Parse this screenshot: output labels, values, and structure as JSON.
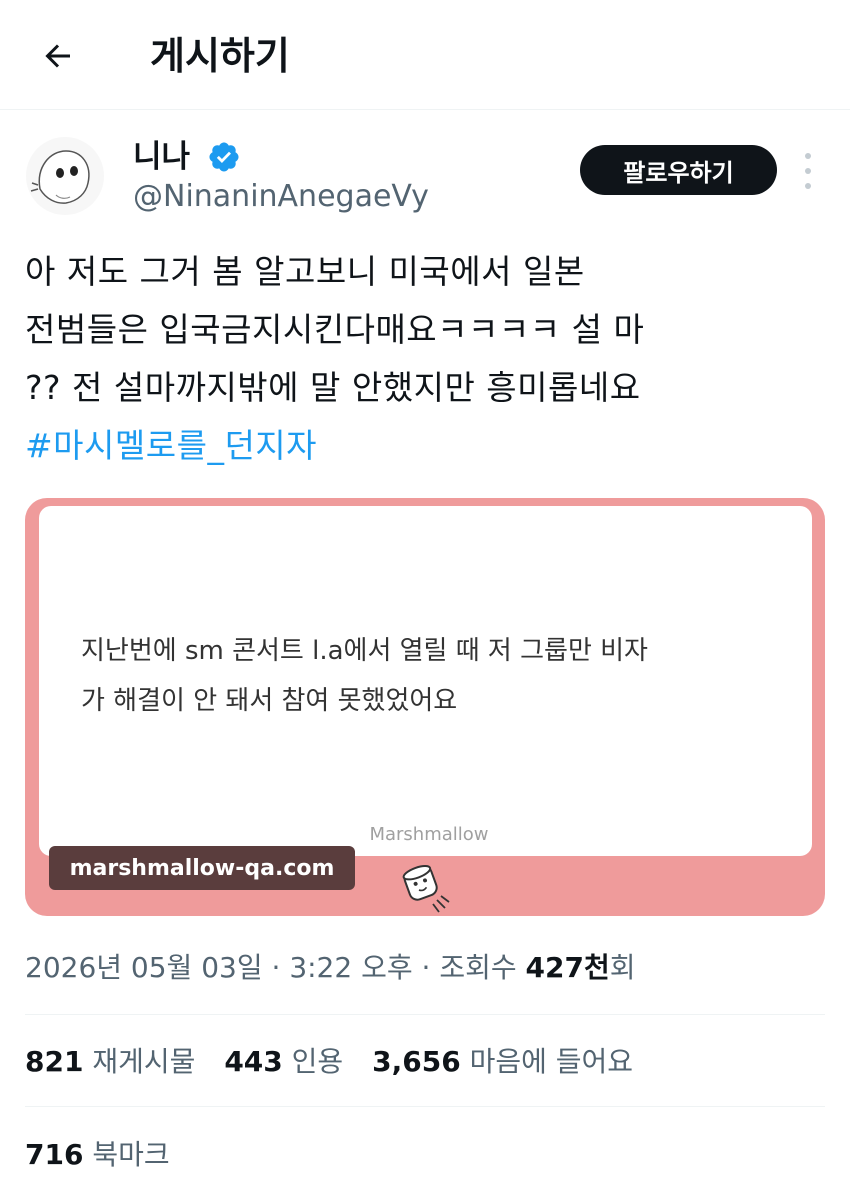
{
  "header": {
    "title": "게시하기",
    "back_icon": "arrow-left-icon"
  },
  "author": {
    "name": "니나",
    "handle": "@NinaninAnegaeVy",
    "verified_icon": "verified-badge-icon",
    "follow_label": "팔로우하기",
    "more_icon": "more-vertical-icon"
  },
  "tweet": {
    "lines": [
      "아 저도 그거 봄 알고보니 미국에서 일본",
      "전범들은 입국금지시킨다매요ㅋㅋㅋㅋ 설 마",
      "?? 전 설마까지밖에 말 안했지만 흥미롭네요"
    ],
    "hashtag": "#마시멜로를_던지자"
  },
  "card": {
    "question_lines": [
      "지난번에 sm 콘서트 l.a에서 열릴 때 저 그룹만 비자",
      "가 해결이 안 돼서 참여 못했었어요"
    ],
    "brand": "Marshmallow",
    "url": "marshmallow-qa.com",
    "accent_color": "#ef9b9b"
  },
  "meta": {
    "date": "2026년 05월 03일",
    "separator": " · ",
    "time": "3:22 오후",
    "views_label": "조회수",
    "views_value": "427천",
    "views_suffix": "회"
  },
  "stats": {
    "retweets": "821",
    "retweets_label": "재게시물",
    "quotes": "443",
    "quotes_label": "인용",
    "likes": "3,656",
    "likes_label": "마음에 들어요",
    "bookmarks": "716",
    "bookmarks_label": "북마크"
  }
}
